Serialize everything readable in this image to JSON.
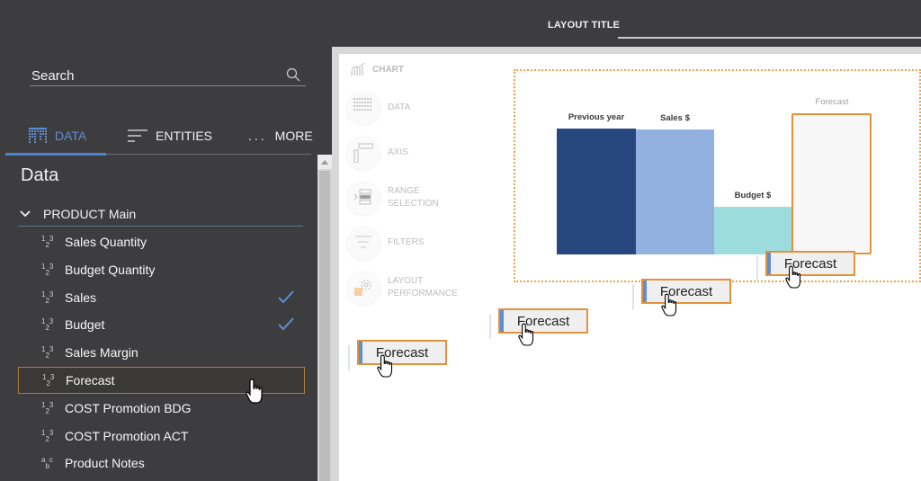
{
  "header": {
    "layout_title": "LAYOUT TITLE"
  },
  "left_panel": {
    "search": {
      "placeholder": "Search",
      "value": ""
    },
    "tabs": [
      {
        "label": "DATA",
        "icon": "data-grid-icon",
        "active": true
      },
      {
        "label": "ENTITIES",
        "icon": "lines-icon",
        "active": false
      },
      {
        "label": "MORE",
        "icon": "ellipsis-icon",
        "active": false
      }
    ],
    "section_title": "Data",
    "group": {
      "label": "PRODUCT Main",
      "expanded": true
    },
    "fields": [
      {
        "label": "Sales Quantity",
        "type": "numeric",
        "type_glyph": "123",
        "checked": false,
        "selected": false
      },
      {
        "label": "Budget Quantity",
        "type": "numeric",
        "type_glyph": "123",
        "checked": false,
        "selected": false
      },
      {
        "label": "Sales",
        "type": "numeric",
        "type_glyph": "123",
        "checked": true,
        "selected": false
      },
      {
        "label": "Budget",
        "type": "numeric",
        "type_glyph": "123",
        "checked": true,
        "selected": false
      },
      {
        "label": "Sales Margin",
        "type": "numeric",
        "type_glyph": "123",
        "checked": false,
        "selected": false
      },
      {
        "label": "Forecast",
        "type": "numeric",
        "type_glyph": "123",
        "checked": false,
        "selected": true
      },
      {
        "label": "COST Promotion BDG",
        "type": "numeric",
        "type_glyph": "123",
        "checked": false,
        "selected": false
      },
      {
        "label": "COST Promotion ACT",
        "type": "numeric",
        "type_glyph": "123",
        "checked": false,
        "selected": false
      },
      {
        "label": "Product Notes",
        "type": "text",
        "type_glyph": "abc",
        "checked": false,
        "selected": false
      }
    ]
  },
  "chart_menu": {
    "title": "CHART",
    "items": [
      {
        "label_1": "DATA",
        "label_2": "",
        "icon": "data-grid-icon"
      },
      {
        "label_1": "AXIS",
        "label_2": "",
        "icon": "axis-icon"
      },
      {
        "label_1": "RANGE",
        "label_2": "SELECTION",
        "icon": "range-selection-icon"
      },
      {
        "label_1": "FILTERS",
        "label_2": "",
        "icon": "filter-icon"
      },
      {
        "label_1": "LAYOUT",
        "label_2": "PERFORMANCE",
        "icon": "gear-icon"
      }
    ]
  },
  "chart": {
    "bars": [
      {
        "label": "Previous year",
        "value": 100,
        "color": "#27477f",
        "placeholder": false
      },
      {
        "label": "Sales $",
        "value": 99,
        "color": "#93b1e0",
        "placeholder": false
      },
      {
        "label": "Budget $",
        "value": 38,
        "color": "#9cdcdc",
        "placeholder": false
      },
      {
        "label": "Forecast",
        "value": 112,
        "color": "#f7f7f7",
        "placeholder": true
      }
    ],
    "max": 112,
    "accent_color": "#e3923b"
  },
  "drag": {
    "chip_label": "Forecast",
    "steps": 4
  }
}
